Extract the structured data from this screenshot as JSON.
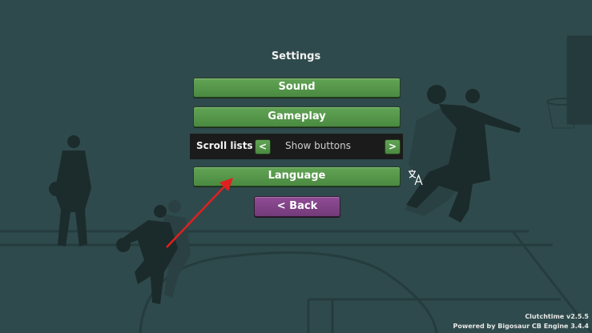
{
  "menu": {
    "title": "Settings",
    "sound_label": "Sound",
    "gameplay_label": "Gameplay",
    "scroll_lists": {
      "label": "Scroll lists",
      "prev": "<",
      "value": "Show buttons",
      "next": ">"
    },
    "language_label": "Language",
    "back_label": "< Back"
  },
  "footer": {
    "version": "Clutchtime v2.5.5",
    "engine": "Powered by Bigosaur CB Engine 3.4.4"
  },
  "icons": {
    "language": "translate-icon",
    "pointer": "red-arrow-annotation"
  },
  "colors": {
    "background": "#2f4a4c",
    "button_green": "#549a49",
    "button_purple": "#803f86",
    "annotation_arrow": "#e02020"
  }
}
